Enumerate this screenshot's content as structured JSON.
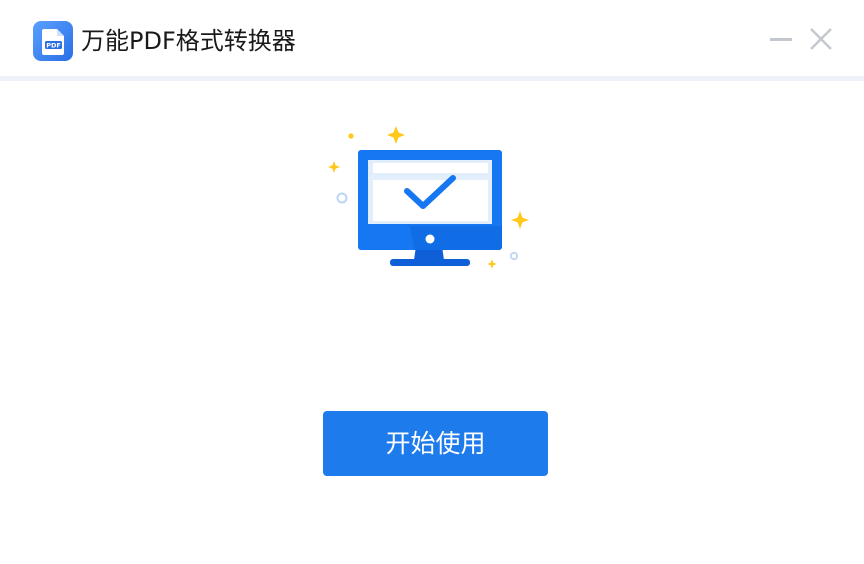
{
  "window": {
    "title": "万能PDF格式转换器",
    "logo_text": "PDF"
  },
  "controls": {
    "minimize_icon": "minimize-icon",
    "close_icon": "close-icon"
  },
  "main": {
    "illustration_icon": "monitor-checkmark-icon",
    "start_button_label": "开始使用"
  },
  "colors": {
    "accent": "#1e7bec",
    "monitor_blue": "#1677f2",
    "sparkle_yellow": "#ffc81a",
    "divider": "#eef2f8"
  }
}
